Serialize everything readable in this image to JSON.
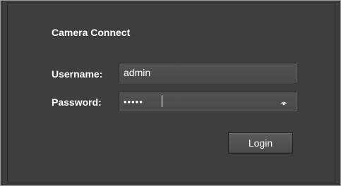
{
  "window": {
    "title": "Camera Connect"
  },
  "form": {
    "username_label": "Username:",
    "username_value": "admin",
    "password_label": "Password:",
    "password_mask": "•••••",
    "login_label": "Login"
  },
  "icons": {
    "show_password": "eye-icon"
  },
  "colors": {
    "background": "#3c3c3c",
    "text": "#ffffff",
    "field_bg": "#4e4e4e"
  }
}
